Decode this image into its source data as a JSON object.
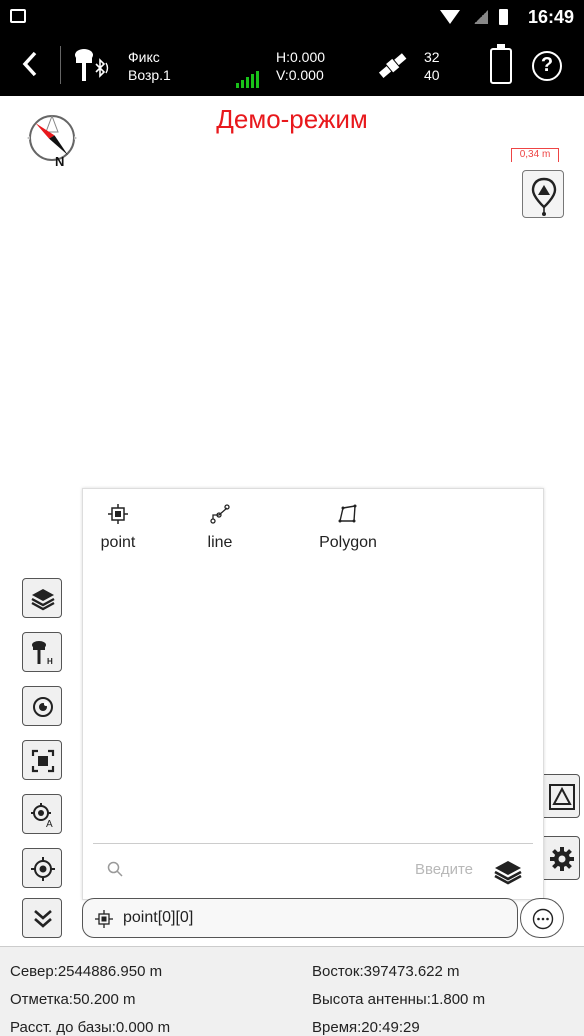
{
  "status_bar": {
    "time": "16:49"
  },
  "toolbar": {
    "solution": "Фикс",
    "age": "Возр.1",
    "h": "H:0.000",
    "v": "V:0.000",
    "sats_used": "32",
    "sats_total": "40"
  },
  "map": {
    "demo_label": "Демо-режим",
    "compass_letter": "N",
    "scale_label": "0,34 m"
  },
  "panel": {
    "types": [
      {
        "label": "point",
        "icon": "point-icon"
      },
      {
        "label": "line",
        "icon": "line-icon"
      },
      {
        "label": "Polygon",
        "icon": "polygon-icon"
      }
    ],
    "search_placeholder": "Введите"
  },
  "current_feature": {
    "name": "point[0][0]"
  },
  "info": {
    "north": "Север:2544886.950 m",
    "east": "Восток:397473.622 m",
    "elevation": "Отметка:50.200 m",
    "antenna": "Высота антенны:1.800 m",
    "base_dist": "Расст. до базы:0.000 m",
    "time": "Время:20:49:29"
  },
  "colors": {
    "demo": "#e8181c",
    "signal": "#19c219"
  }
}
